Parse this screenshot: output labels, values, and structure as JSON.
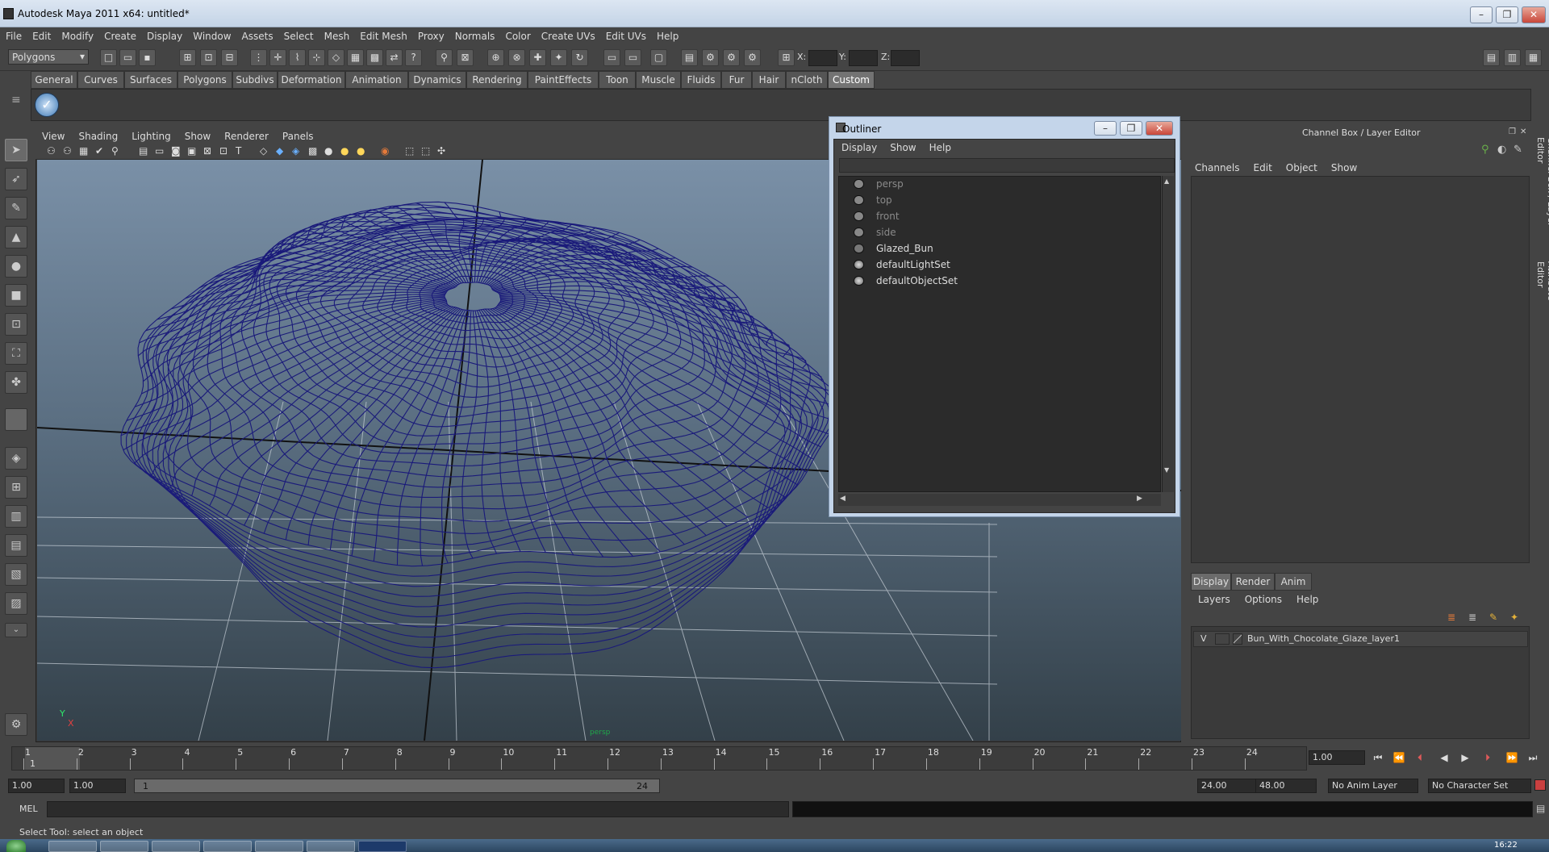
{
  "window": {
    "title": "Autodesk Maya 2011 x64: untitled*",
    "buttons": [
      "–",
      "❐",
      "✕"
    ]
  },
  "menubar": [
    "File",
    "Edit",
    "Modify",
    "Create",
    "Display",
    "Window",
    "Assets",
    "Select",
    "Mesh",
    "Edit Mesh",
    "Proxy",
    "Normals",
    "Color",
    "Create UVs",
    "Edit UVs",
    "Help"
  ],
  "statusline": {
    "mode": "Polygons",
    "x_label": "X:",
    "y_label": "Y:",
    "z_label": "Z:"
  },
  "shelf": {
    "tabs": [
      "General",
      "Curves",
      "Surfaces",
      "Polygons",
      "Subdivs",
      "Deformation",
      "Animation",
      "Dynamics",
      "Rendering",
      "PaintEffects",
      "Toon",
      "Muscle",
      "Fluids",
      "Fur",
      "Hair",
      "nCloth",
      "Custom"
    ],
    "active_tab": "Custom"
  },
  "viewport": {
    "menu": [
      "View",
      "Shading",
      "Lighting",
      "Show",
      "Renderer",
      "Panels"
    ],
    "camera_label": "persp",
    "axis_y": "Y",
    "axis_x": "X",
    "wire_color": "#1a1a7a"
  },
  "outliner": {
    "title": "Outliner",
    "menu": [
      "Display",
      "Show",
      "Help"
    ],
    "items": [
      {
        "label": "persp",
        "dim": true
      },
      {
        "label": "top",
        "dim": true
      },
      {
        "label": "front",
        "dim": true
      },
      {
        "label": "side",
        "dim": true
      },
      {
        "label": "Glazed_Bun",
        "dim": false
      },
      {
        "label": "defaultLightSet",
        "dim": false
      },
      {
        "label": "defaultObjectSet",
        "dim": false
      }
    ]
  },
  "channel_box": {
    "title": "Channel Box / Layer Editor",
    "menu": [
      "Channels",
      "Edit",
      "Object",
      "Show"
    ]
  },
  "layer_editor": {
    "tabs": [
      "Display",
      "Render",
      "Anim"
    ],
    "active_tab": "Display",
    "menu": [
      "Layers",
      "Options",
      "Help"
    ],
    "layer": {
      "visible": "V",
      "name": "Bun_With_Chocolate_Glaze_layer1"
    }
  },
  "side_tabs": [
    "Channel Box / Layer Editor",
    "Attribute Editor"
  ],
  "timeline": {
    "ticks": [
      "1",
      "2",
      "3",
      "4",
      "5",
      "6",
      "7",
      "8",
      "9",
      "10",
      "11",
      "12",
      "13",
      "14",
      "15",
      "16",
      "17",
      "18",
      "19",
      "20",
      "21",
      "22",
      "23",
      "24"
    ],
    "current_frame_marker": "1",
    "current_time": "1.00"
  },
  "range": {
    "start": "1.00",
    "anim_start": "1.00",
    "slider_start": "1",
    "slider_end": "24",
    "end": "24.00",
    "anim_end": "48.00",
    "anim_layer": "No Anim Layer",
    "char_set": "No Character Set"
  },
  "command": {
    "label": "MEL"
  },
  "help_line": "Select Tool: select an object",
  "clock": "16:22"
}
